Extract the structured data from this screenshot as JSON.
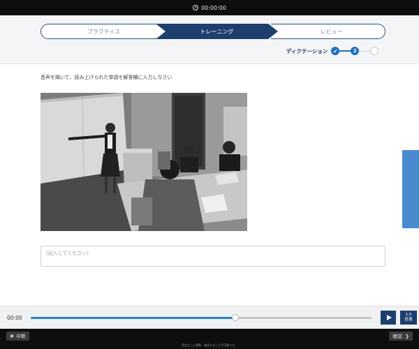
{
  "topbar": {
    "timer": "00:00:00",
    "timer_icon": "clock-icon"
  },
  "steps": {
    "items": [
      "プラクティス",
      "トレーニング",
      "レビュー"
    ],
    "active_index": 1
  },
  "substeps": {
    "label": "ディクテーション",
    "done_mark": "✔",
    "current_number": "2"
  },
  "instruction": "音声を聞いて、読み上げられた単語を解答欄に入力しなさい",
  "answer": {
    "placeholder": "(記入してください)",
    "value": ""
  },
  "player": {
    "time": "00:00",
    "progress": 0.6,
    "speed_value": "1.0",
    "speed_unit": "倍速",
    "play_icon": "play-icon"
  },
  "footer": {
    "quit_label": "中断",
    "quit_icon": "close-icon",
    "confirm_label": "確認",
    "confirm_icon": "chevron-right-icon",
    "note": "設定なしに移動、確認することが可能です。"
  },
  "colors": {
    "navy": "#1e3f6e",
    "accent": "#1f6fbf",
    "side_tab": "#4a8bd0"
  }
}
